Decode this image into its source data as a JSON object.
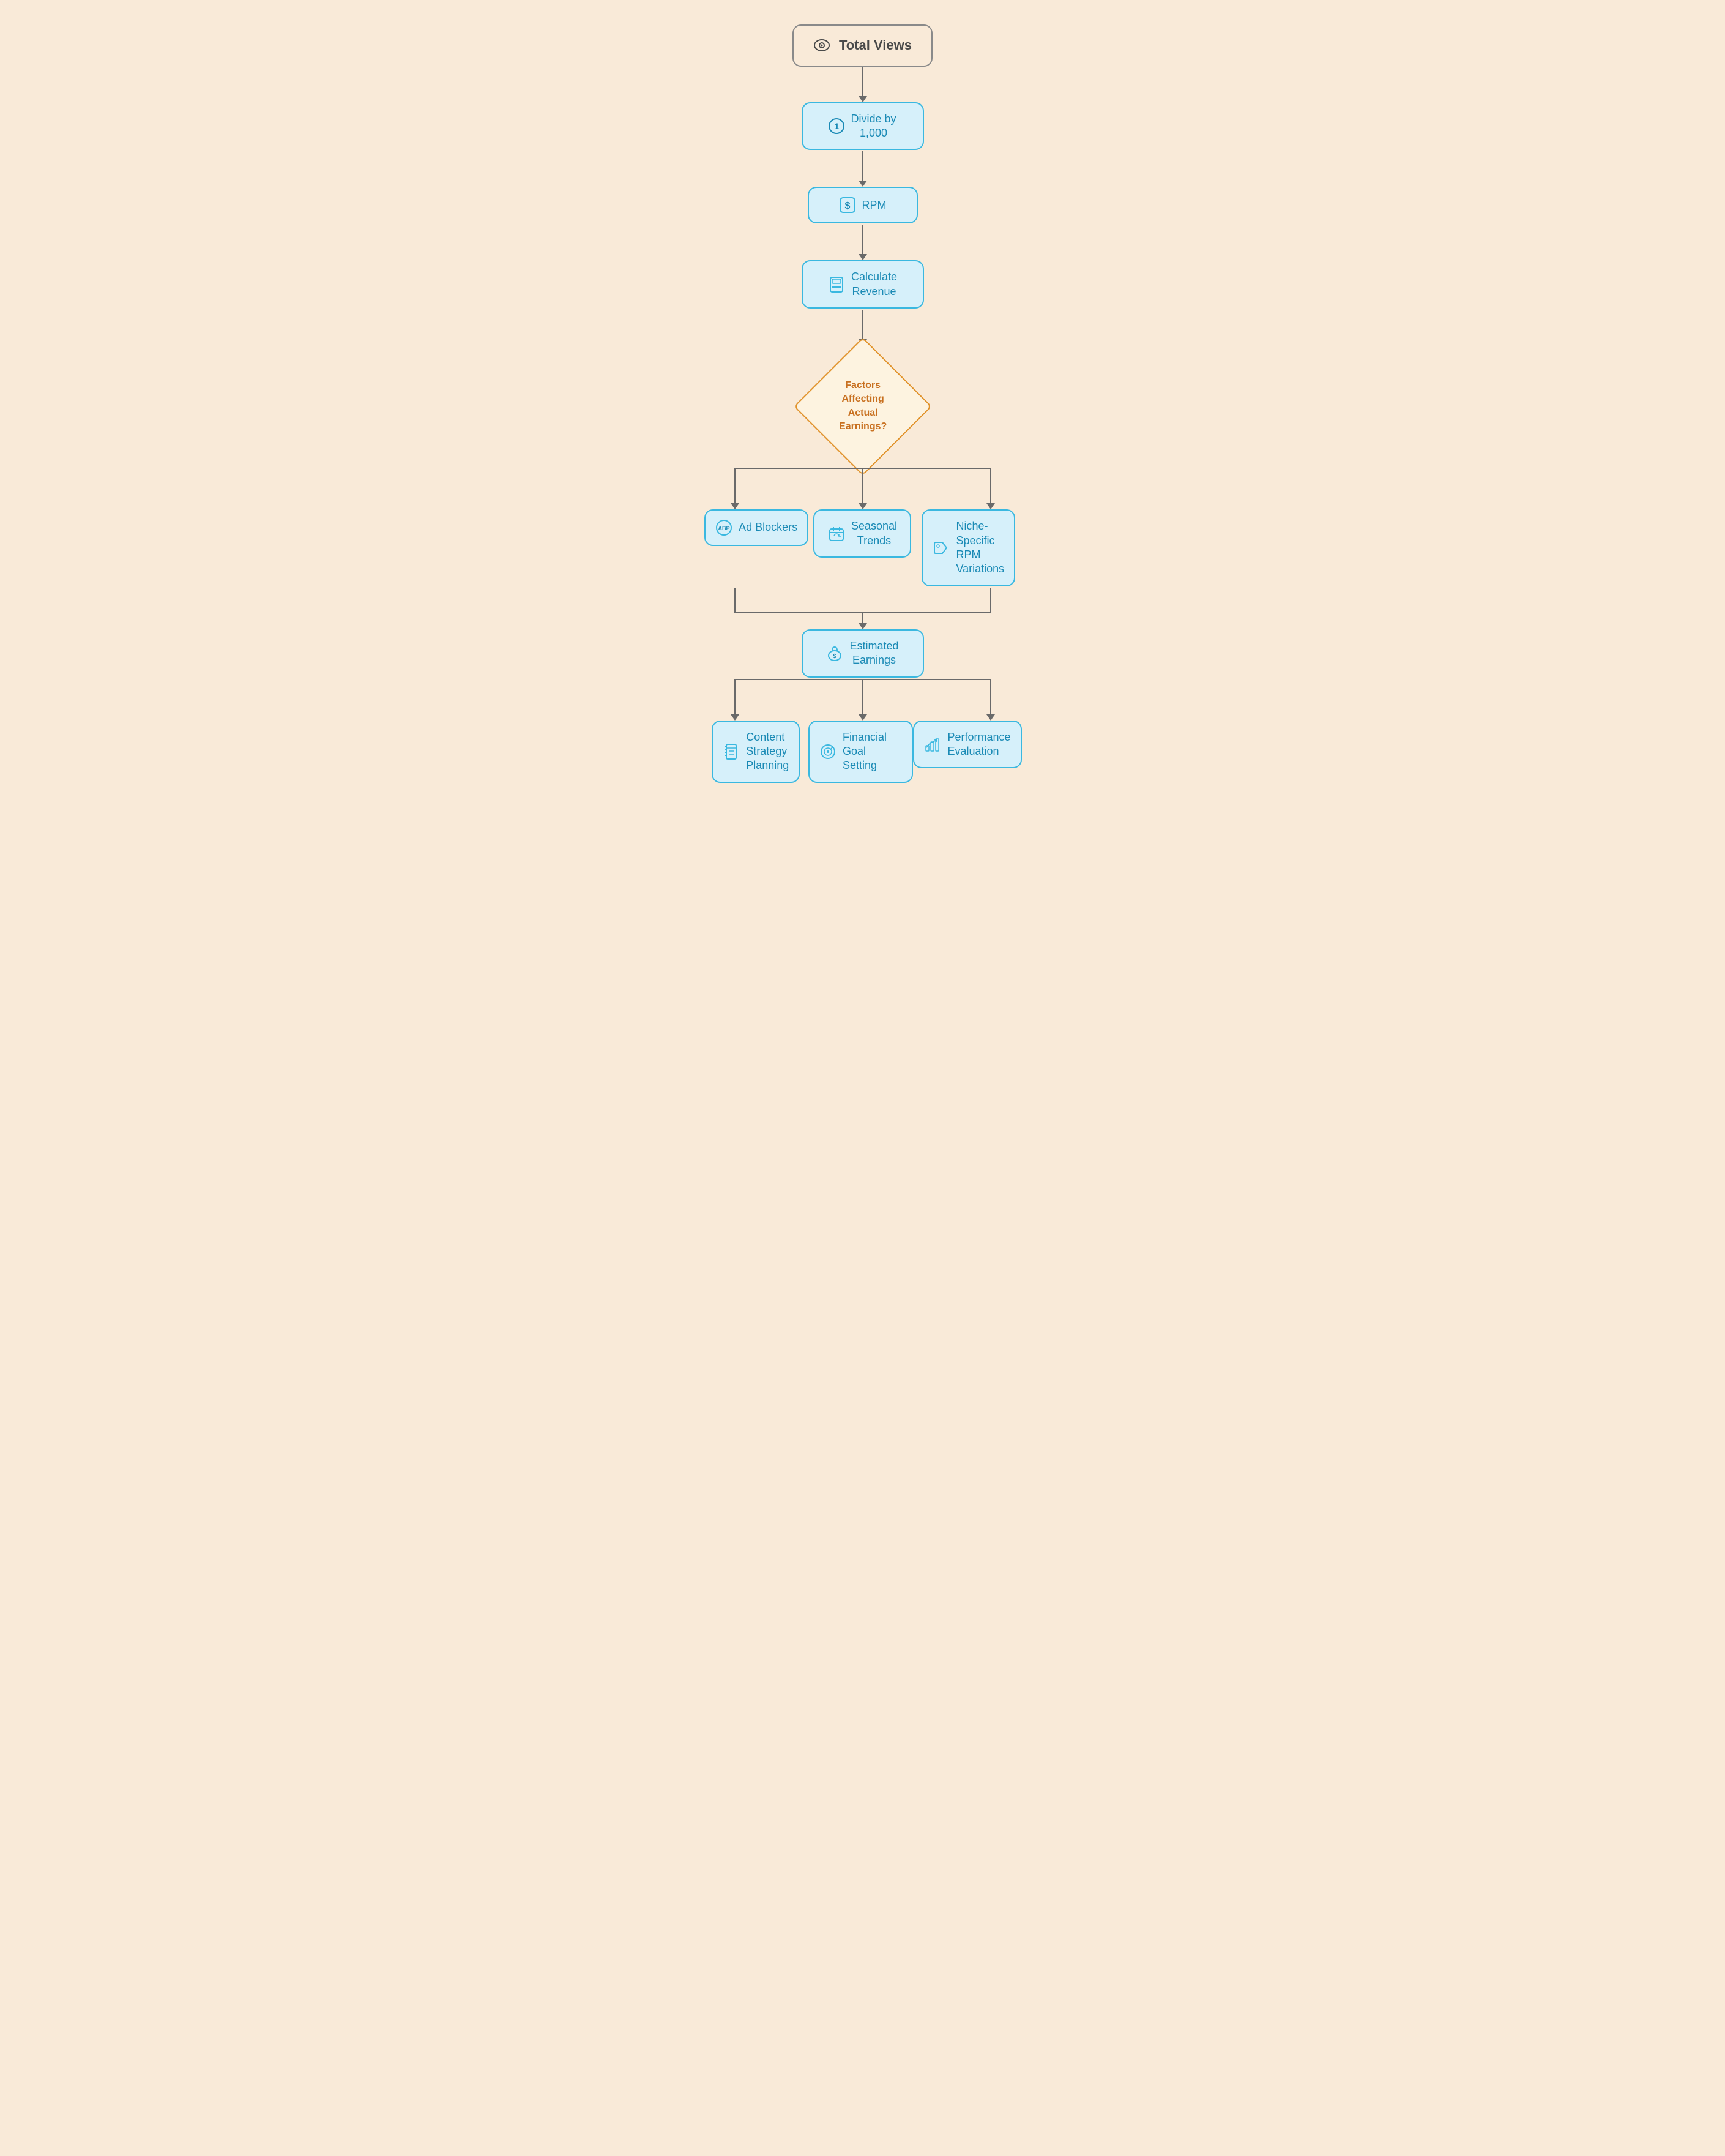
{
  "nodes": {
    "total_views": {
      "label": "Total Views",
      "icon": "eye-icon"
    },
    "divide": {
      "badge": "1",
      "label": "Divide by\n1,000"
    },
    "rpm": {
      "label": "RPM",
      "icon": "dollar-icon"
    },
    "calculate": {
      "label": "Calculate\nRevenue",
      "icon": "calculator-icon"
    },
    "diamond": {
      "label": "Factors\nAffecting\nActual\nEarnings?"
    },
    "ad_blockers": {
      "label": "Ad Blockers",
      "icon": "adblock-icon"
    },
    "seasonal_trends": {
      "label": "Seasonal\nTrends",
      "icon": "calendar-icon"
    },
    "niche_rpm": {
      "label": "Niche-\nSpecific\nRPM\nVariations",
      "icon": "tag-icon"
    },
    "estimated_earnings": {
      "label": "Estimated\nEarnings",
      "icon": "moneybag-icon"
    },
    "content_strategy": {
      "label": "Content\nStrategy\nPlanning",
      "icon": "notebook-icon"
    },
    "financial_goal": {
      "label": "Financial\nGoal Setting",
      "icon": "goal-icon"
    },
    "performance_eval": {
      "label": "Performance\nEvaluation",
      "icon": "chart-icon"
    }
  },
  "colors": {
    "bg": "#f9ead8",
    "blue_border": "#3ab8e0",
    "blue_bg": "#d6f0fa",
    "blue_text": "#1a8ab5",
    "orange_border": "#e0922a",
    "orange_bg": "#fdf3e0",
    "orange_text": "#c87020",
    "arrow": "#6a6a6a",
    "start_border": "#8a8a8a",
    "start_text": "#4a4a4a"
  }
}
